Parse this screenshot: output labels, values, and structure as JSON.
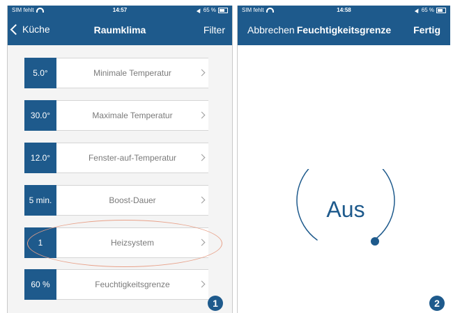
{
  "colors": {
    "accent": "#1e5a8c",
    "highlight": "#e8a189"
  },
  "screen1": {
    "status": {
      "carrier": "SIM fehlt",
      "time": "14:57",
      "battery": "65 %"
    },
    "nav": {
      "back": "Küche",
      "title": "Raumklima",
      "action": "Filter"
    },
    "rows": [
      {
        "value": "5.0°",
        "label": "Minimale Temperatur"
      },
      {
        "value": "30.0°",
        "label": "Maximale Temperatur"
      },
      {
        "value": "12.0°",
        "label": "Fenster-auf-Temperatur"
      },
      {
        "value": "5 min.",
        "label": "Boost-Dauer"
      },
      {
        "value": "1",
        "label": "Heizsystem"
      },
      {
        "value": "60 %",
        "label": "Feuchtigkeitsgrenze"
      }
    ],
    "badge": "1"
  },
  "screen2": {
    "status": {
      "carrier": "SIM fehlt",
      "time": "14:58",
      "battery": "65 %"
    },
    "nav": {
      "cancel": "Abbrechen",
      "title": "Feuchtigkeitsgrenze",
      "done": "Fertig"
    },
    "dial": {
      "value": "Aus"
    },
    "badge": "2"
  }
}
